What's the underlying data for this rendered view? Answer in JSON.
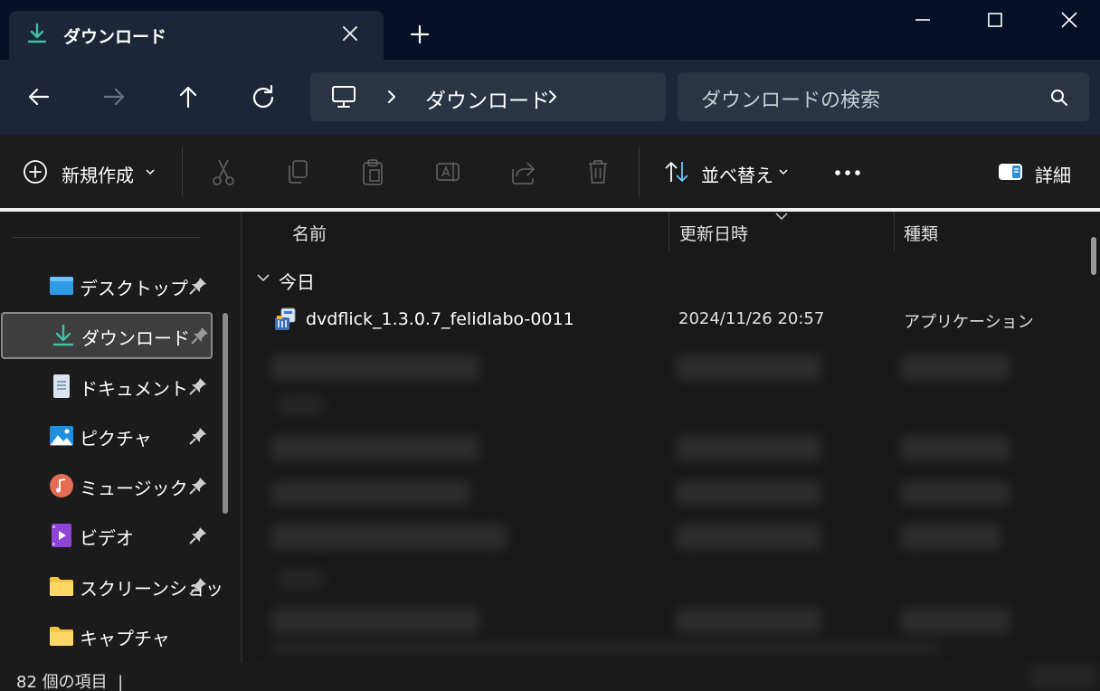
{
  "window": {
    "tab_title": "ダウンロード",
    "tab_icon": "download-icon"
  },
  "navigation": {
    "address": {
      "location": "ダウンロード",
      "root_icon": "pc-monitor-icon"
    },
    "search": {
      "placeholder": "ダウンロードの検索"
    }
  },
  "command_bar": {
    "new_label": "新規作成",
    "sort_label": "並べ替え",
    "details_label": "詳細"
  },
  "sidebar": {
    "items": [
      {
        "label": "デスクトップ",
        "icon": "desktop-folder-icon",
        "pinned": true
      },
      {
        "label": "ダウンロード",
        "icon": "download-icon",
        "pinned": true,
        "selected": true
      },
      {
        "label": "ドキュメント",
        "icon": "document-icon",
        "pinned": true
      },
      {
        "label": "ピクチャ",
        "icon": "pictures-icon",
        "pinned": true
      },
      {
        "label": "ミュージック",
        "icon": "music-icon",
        "pinned": true
      },
      {
        "label": "ビデオ",
        "icon": "video-icon",
        "pinned": true
      },
      {
        "label": "スクリーンショッ",
        "icon": "folder-icon",
        "pinned": true
      },
      {
        "label": "キャプチャ",
        "icon": "folder-icon",
        "pinned": false
      }
    ]
  },
  "file_list": {
    "columns": [
      "名前",
      "更新日時",
      "種類"
    ],
    "group_label": "今日",
    "files": [
      {
        "name": "dvdflick_1.3.0.7_felidlabo-0011",
        "modified": "2024/11/26 20:57",
        "type": "アプリケーション"
      }
    ]
  },
  "status": {
    "item_count": "82 個の項目  |"
  },
  "colors": {
    "titlebar_bg": "#061127",
    "tab_bg": "#1c2638",
    "accent_download": "#3fc1a5",
    "content_bg": "#191919"
  }
}
